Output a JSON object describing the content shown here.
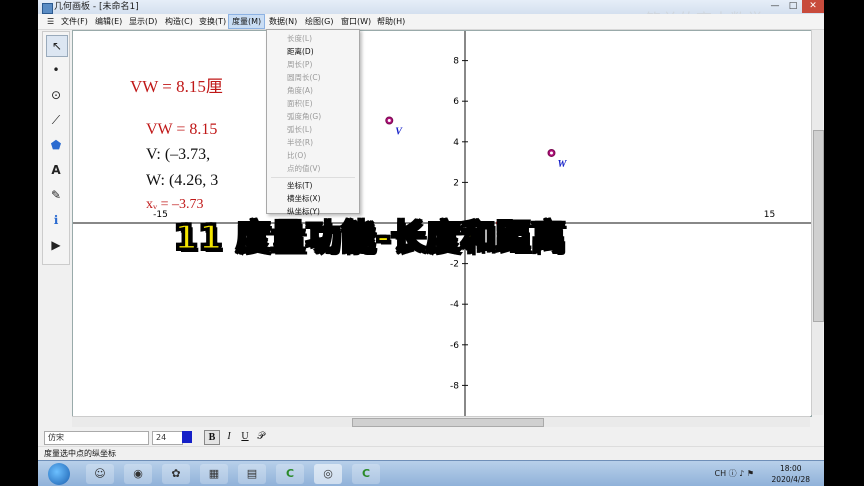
{
  "window": {
    "title": "几何画板 - [未命名1]",
    "watermark": "简单的高中数学",
    "minimize": "—",
    "maximize": "□",
    "close": "✕"
  },
  "menubar": [
    {
      "label": "文件(F)"
    },
    {
      "label": "编辑(E)"
    },
    {
      "label": "显示(D)"
    },
    {
      "label": "构造(C)"
    },
    {
      "label": "变换(T)"
    },
    {
      "label": "度量(M)"
    },
    {
      "label": "数据(N)"
    },
    {
      "label": "绘图(G)"
    },
    {
      "label": "窗口(W)"
    },
    {
      "label": "帮助(H)"
    }
  ],
  "menu_icon": "☰",
  "toolbar_tools": [
    {
      "icon": "arrow-select-icon",
      "glyph": "↖"
    },
    {
      "icon": "point-icon",
      "glyph": "•"
    },
    {
      "icon": "compass-icon",
      "glyph": "⊙"
    },
    {
      "icon": "straightedge-icon",
      "glyph": "⟋"
    },
    {
      "icon": "polygon-icon",
      "glyph": "⬟"
    },
    {
      "icon": "text-icon",
      "glyph": "A"
    },
    {
      "icon": "marker-icon",
      "glyph": "✎"
    },
    {
      "icon": "info-icon",
      "glyph": "ℹ"
    },
    {
      "icon": "custom-tools-icon",
      "glyph": "▶"
    }
  ],
  "measure_menu": {
    "items": [
      {
        "label": "长度(L)",
        "enabled": false
      },
      {
        "label": "距离(D)",
        "enabled": true
      },
      {
        "label": "周长(P)",
        "enabled": false
      },
      {
        "label": "圆周长(C)",
        "enabled": false
      },
      {
        "label": "角度(A)",
        "enabled": false
      },
      {
        "label": "面积(E)",
        "enabled": false
      },
      {
        "label": "弧度角(G)",
        "enabled": false
      },
      {
        "label": "弧长(L)",
        "enabled": false
      },
      {
        "label": "半径(R)",
        "enabled": false
      },
      {
        "label": "比(O)",
        "enabled": false
      },
      {
        "label": "点的值(V)",
        "enabled": false
      },
      {
        "label": "坐标(T)",
        "enabled": true
      },
      {
        "label": "横坐标(X)",
        "enabled": true
      },
      {
        "label": "纵坐标(Y)",
        "enabled": true
      }
    ]
  },
  "measurements": {
    "dist_big": "VW = 8.15厘",
    "dist_small": "VW = 8.15",
    "v_coord": "V: (–3.73,",
    "w_coord": "W: (4.26, 3",
    "xv": "xᵥ = –3.73"
  },
  "graph": {
    "y_ticks": [
      "8",
      "6",
      "4",
      "2",
      "-2",
      "-4",
      "-6",
      "-8"
    ],
    "x_ticks": [
      "-15",
      "15"
    ],
    "points": [
      {
        "label": "V",
        "x": -3.73,
        "y": 5.05
      },
      {
        "label": "W",
        "x": 4.26,
        "y": 3.45
      }
    ]
  },
  "banner": "11 度量功能-长度和距离",
  "formatbar": {
    "font": "仿宋",
    "size": "24",
    "bold": "B",
    "italic": "I",
    "underline": "U",
    "symbol": "𝒫"
  },
  "statusbar": "度量选中点的纵坐标",
  "taskbar": {
    "apps": [
      "☺",
      "◉",
      "✿",
      "▦",
      "▤",
      "C",
      "◎",
      "C"
    ],
    "tray": "CH  ⓘ  ♪  ⚑",
    "time": "18:00",
    "date": "2020/4/28"
  }
}
